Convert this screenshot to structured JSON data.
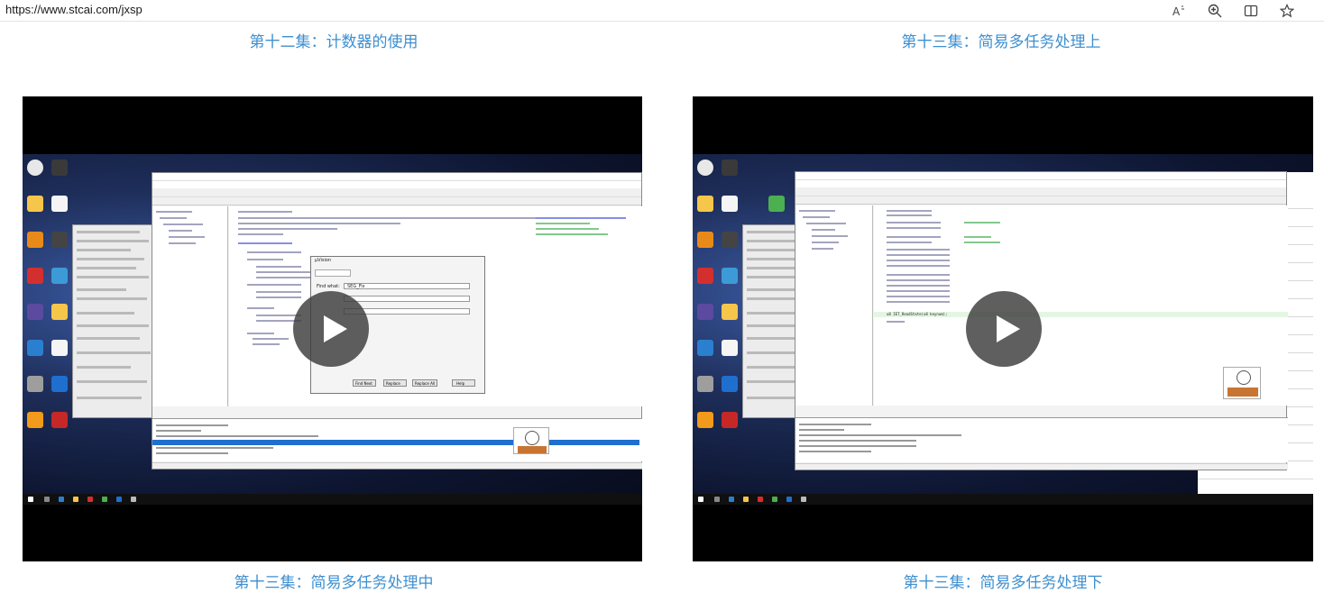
{
  "browser": {
    "url": "https://www.stcai.com/jxsp",
    "icons": [
      "read-aloud-icon",
      "zoom-icon",
      "split-screen-icon",
      "favorite-star-icon"
    ]
  },
  "top_captions": {
    "left": "第十二集：计数器的使用",
    "right": "第十三集：简易多任务处理上"
  },
  "videos": [
    {
      "caption": "第十三集：简易多任务处理中",
      "dialog_title": "μVision",
      "dialog_find_label": "Find what:",
      "dialog_find_value": "SEG_Fix",
      "dialog_buttons": [
        "Find Next",
        "Replace",
        "Replace All",
        "Help"
      ]
    },
    {
      "caption": "第十三集：简易多任务处理下",
      "code_highlight": "u8 IET_ReadState(u8 keynum);"
    }
  ],
  "colors": {
    "caption": "#3d8fd0",
    "video_bg": "#000000",
    "play_button": "#3c3c3c"
  }
}
